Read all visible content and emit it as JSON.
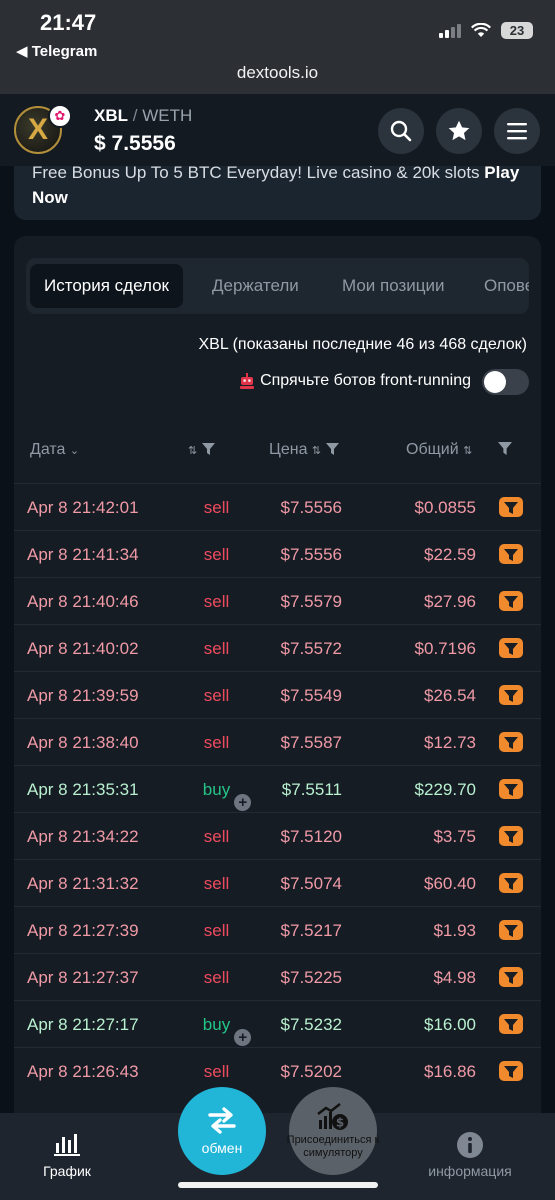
{
  "status_bar": {
    "time": "21:47",
    "back_app": "◀ Telegram",
    "battery": "23"
  },
  "browser": {
    "url": "dextools.io"
  },
  "header": {
    "logo_letter": "X",
    "base": "XBL",
    "separator": "/",
    "quote": "WETH",
    "price": "$ 7.5556",
    "icons": [
      "search-icon",
      "star-icon",
      "menu-icon"
    ]
  },
  "promo": {
    "text": "Free Bonus Up To 5 BTC Everyday! Live casino & 20k slots",
    "cta": "Play Now"
  },
  "tabs": [
    "История сделок",
    "Держатели",
    "Мои позиции",
    "Опове"
  ],
  "summary": "XBL (показаны последние 46 из 468 сделок)",
  "bots_label": "Спрячьте ботов front-running",
  "bots_toggle_on": false,
  "columns": {
    "date": "Дата",
    "price": "Цена",
    "total": "Общий"
  },
  "trades": [
    {
      "date": "Apr 8 21:42:01",
      "type": "sell",
      "price": "$7.5556",
      "total": "$0.0855"
    },
    {
      "date": "Apr 8 21:41:34",
      "type": "sell",
      "price": "$7.5556",
      "total": "$22.59"
    },
    {
      "date": "Apr 8 21:40:46",
      "type": "sell",
      "price": "$7.5579",
      "total": "$27.96"
    },
    {
      "date": "Apr 8 21:40:02",
      "type": "sell",
      "price": "$7.5572",
      "total": "$0.7196"
    },
    {
      "date": "Apr 8 21:39:59",
      "type": "sell",
      "price": "$7.5549",
      "total": "$26.54"
    },
    {
      "date": "Apr 8 21:38:40",
      "type": "sell",
      "price": "$7.5587",
      "total": "$12.73"
    },
    {
      "date": "Apr 8 21:35:31",
      "type": "buy",
      "price": "$7.5511",
      "total": "$229.70"
    },
    {
      "date": "Apr 8 21:34:22",
      "type": "sell",
      "price": "$7.5120",
      "total": "$3.75"
    },
    {
      "date": "Apr 8 21:31:32",
      "type": "sell",
      "price": "$7.5074",
      "total": "$60.40"
    },
    {
      "date": "Apr 8 21:27:39",
      "type": "sell",
      "price": "$7.5217",
      "total": "$1.93"
    },
    {
      "date": "Apr 8 21:27:37",
      "type": "sell",
      "price": "$7.5225",
      "total": "$4.98"
    },
    {
      "date": "Apr 8 21:27:17",
      "type": "buy",
      "price": "$7.5232",
      "total": "$16.00"
    },
    {
      "date": "Apr 8 21:26:43",
      "type": "sell",
      "price": "$7.5202",
      "total": "$16.86"
    }
  ],
  "bottom_nav": {
    "chart": "График",
    "swap": "обмен",
    "simulator": "Присоединиться к симулятору",
    "info": "информация"
  },
  "colors": {
    "sell_text": "#f09aa6",
    "sell_type": "#ef4b5e",
    "buy_text": "#b9f0cf",
    "buy_type": "#24c486",
    "swap_button": "#21b6d8",
    "maker_icon": "#f08a2c"
  }
}
